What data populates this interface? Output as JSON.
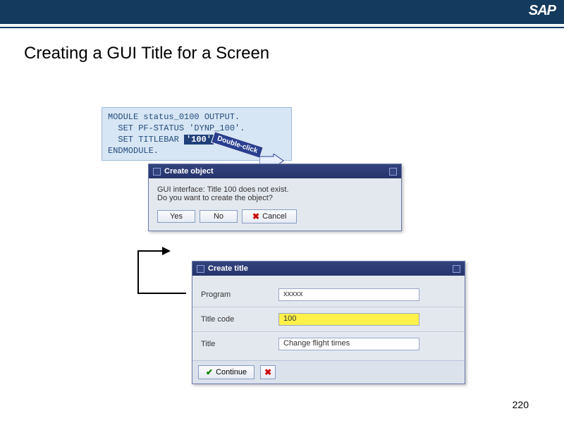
{
  "header": {
    "logo": "SAP"
  },
  "title": "Creating a GUI Title for a Screen",
  "code": {
    "line1": "MODULE status_0100 OUTPUT.",
    "line2": "  SET PF-STATUS 'DYNP_100'.",
    "line3_pre": "  SET TITLEBAR ",
    "line3_hi": "'100'",
    "line3_post": ".",
    "line4": "ENDMODULE.",
    "dbl_click": "Double-click"
  },
  "dialog1": {
    "title": "Create object",
    "line1": "GUI interface: Title 100 does not exist.",
    "line2": "Do you want to create the object?",
    "yes": "Yes",
    "no": "No",
    "cancel": "Cancel"
  },
  "dialog2": {
    "title": "Create title",
    "program_label": "Program",
    "program_value": "xxxxx",
    "code_label": "Title code",
    "code_value": "100",
    "title_label": "Title",
    "title_value": "Change flight times",
    "continue": "Continue"
  },
  "page_number": "220"
}
